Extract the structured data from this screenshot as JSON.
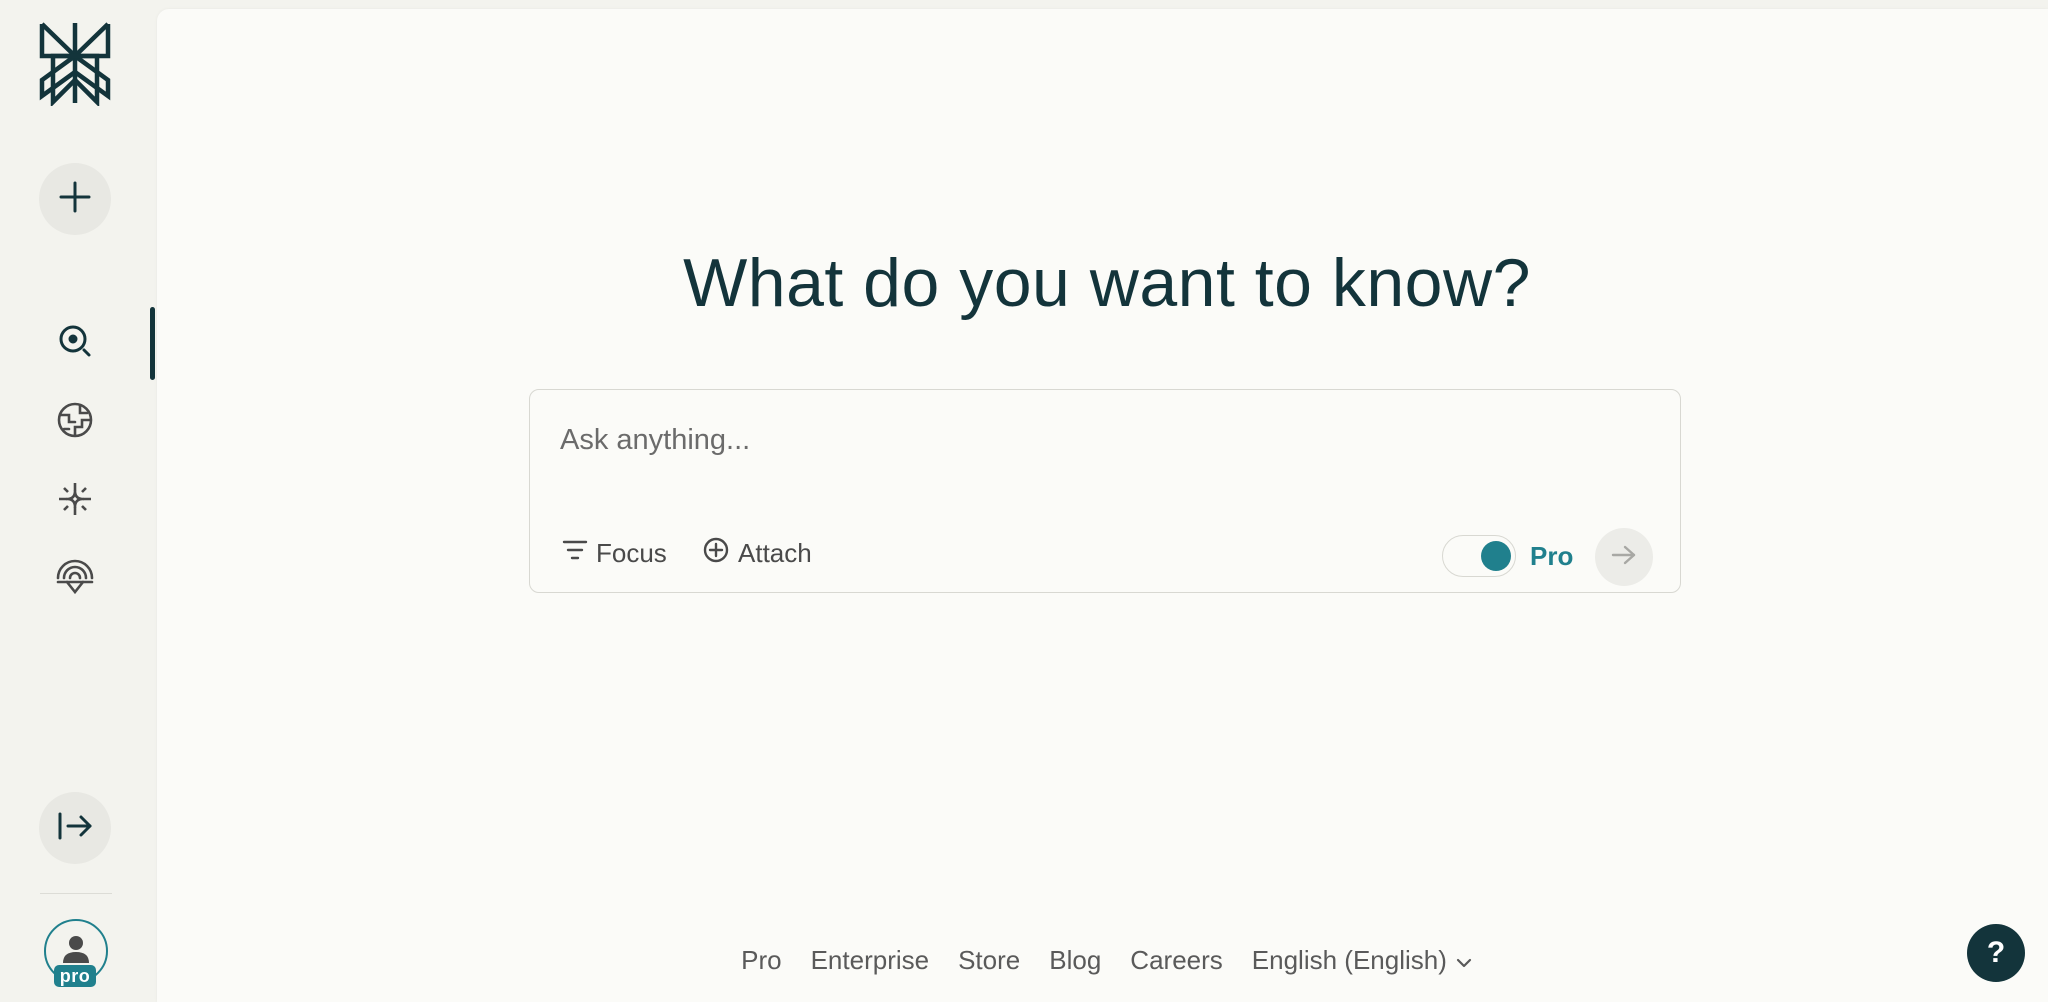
{
  "sidebar": {
    "logo_icon": "perplexity-logo-icon",
    "new_thread_icon": "plus-icon",
    "nav": [
      {
        "name": "home",
        "icon": "search-icon",
        "active": true
      },
      {
        "name": "discover",
        "icon": "globe-icon",
        "active": false
      },
      {
        "name": "spaces",
        "icon": "sparkle-icon",
        "active": false
      },
      {
        "name": "library",
        "icon": "signal-icon",
        "active": false
      }
    ],
    "collapse_icon": "expand-arrow-icon",
    "avatar_icon": "user-icon",
    "avatar_badge": "pro"
  },
  "main": {
    "headline": "What do you want to know?",
    "search": {
      "placeholder": "Ask anything...",
      "focus_label": "Focus",
      "attach_label": "Attach",
      "pro_label": "Pro",
      "pro_enabled": true,
      "submit_icon": "arrow-right-icon"
    }
  },
  "footer": {
    "links": [
      "Pro",
      "Enterprise",
      "Store",
      "Blog",
      "Careers"
    ],
    "language": "English (English)"
  },
  "help_label": "?",
  "colors": {
    "accent": "#20808d",
    "text": "#13343b",
    "sidebar_bg": "#f3f3ee",
    "main_bg": "#fbfbf8"
  }
}
